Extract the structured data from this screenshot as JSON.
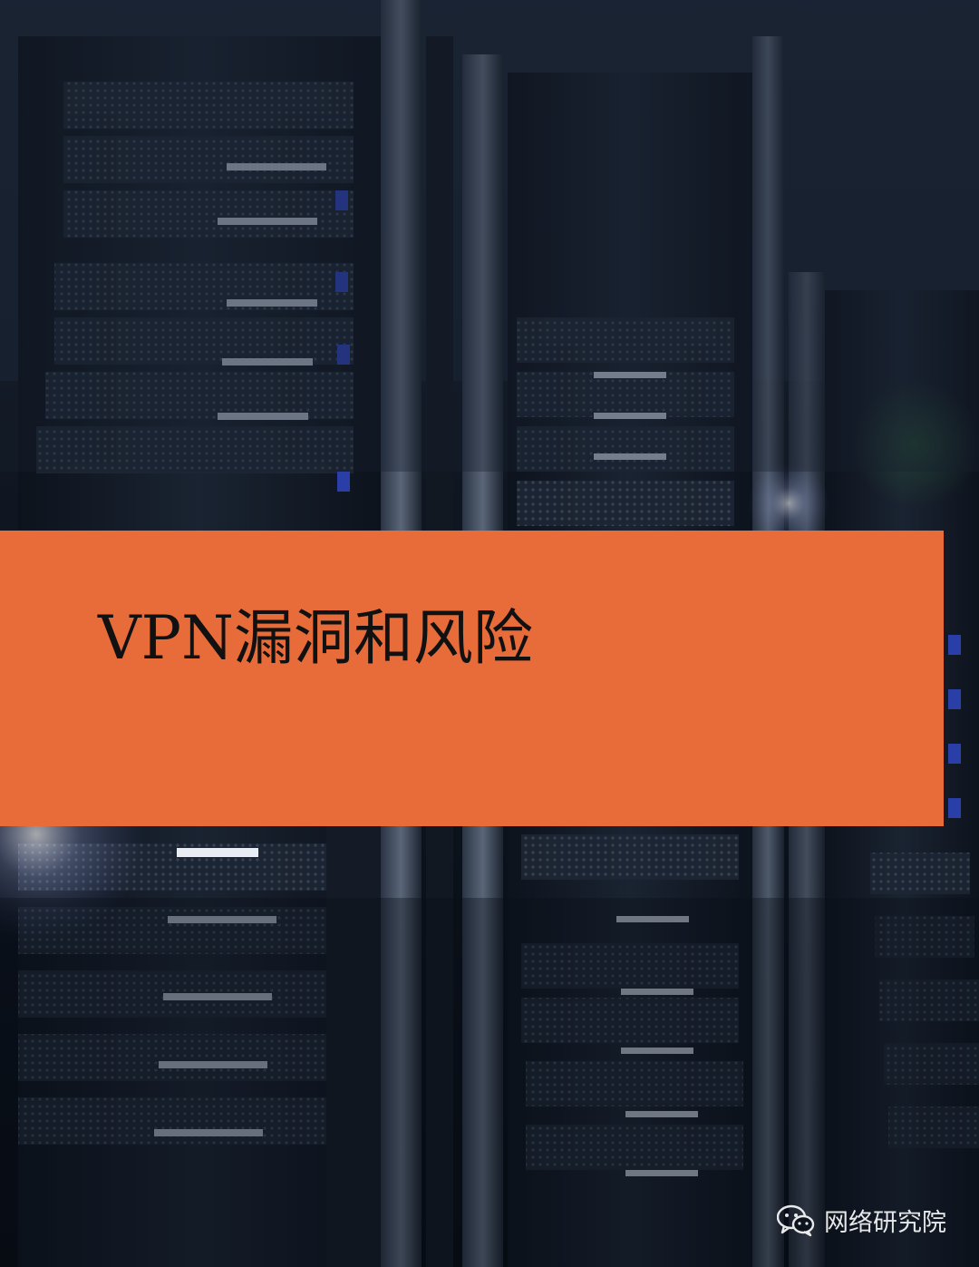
{
  "document": {
    "title": "VPN漏洞和风险"
  },
  "watermark": {
    "icon": "wechat-icon",
    "label": "网络研究院"
  },
  "colors": {
    "banner": "#e86c3a",
    "title_text": "#111111",
    "background": "#0b111b"
  }
}
